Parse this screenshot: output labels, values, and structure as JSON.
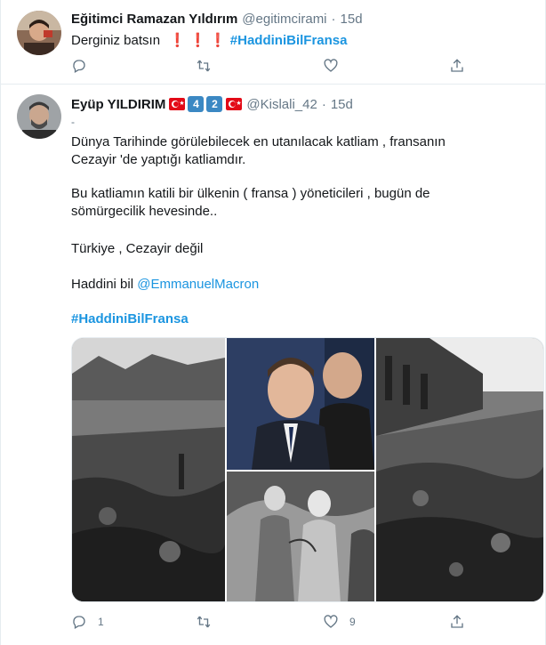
{
  "tweets": [
    {
      "name": "Eğitimci Ramazan Yıldırım",
      "handle": "@egitimcirami",
      "separator": "·",
      "time": "15d",
      "text": "Derginiz batsın",
      "emoji": "❗ ❗ ❗",
      "hashtag": "#HaddiniBilFransa",
      "reply_count": "",
      "like_count": ""
    },
    {
      "name": "Eyüp YILDIRIM",
      "badges": [
        "4",
        "2"
      ],
      "handle": "@Kislali_42",
      "separator": "·",
      "time": "15d",
      "dash": "-",
      "line1": "Dünya Tarihinde görülebilecek en utanılacak katliam , fransanın Cezayir 'de yaptığı katliamdır.",
      "line2": "Bu katliamın katili bir ülkenin ( fransa ) yöneticileri , bugün de sömürgecilik hevesinde..",
      "line3": "Türkiye , Cezayir değil",
      "line4_prefix": "Haddini bil",
      "mention": "@EmmanuelMacron",
      "hashtag": "#HaddiniBilFransa",
      "reply_count": "1",
      "like_count": "9"
    }
  ],
  "icons": {
    "reply": "reply-icon",
    "retweet": "retweet-icon",
    "like": "heart-icon",
    "share": "share-icon"
  },
  "colors": {
    "link": "#1b95e0",
    "secondary_text": "#657786",
    "border": "#e6ecf0",
    "turkish_flag": "#e30a17",
    "keycap": "#3b88c3"
  }
}
